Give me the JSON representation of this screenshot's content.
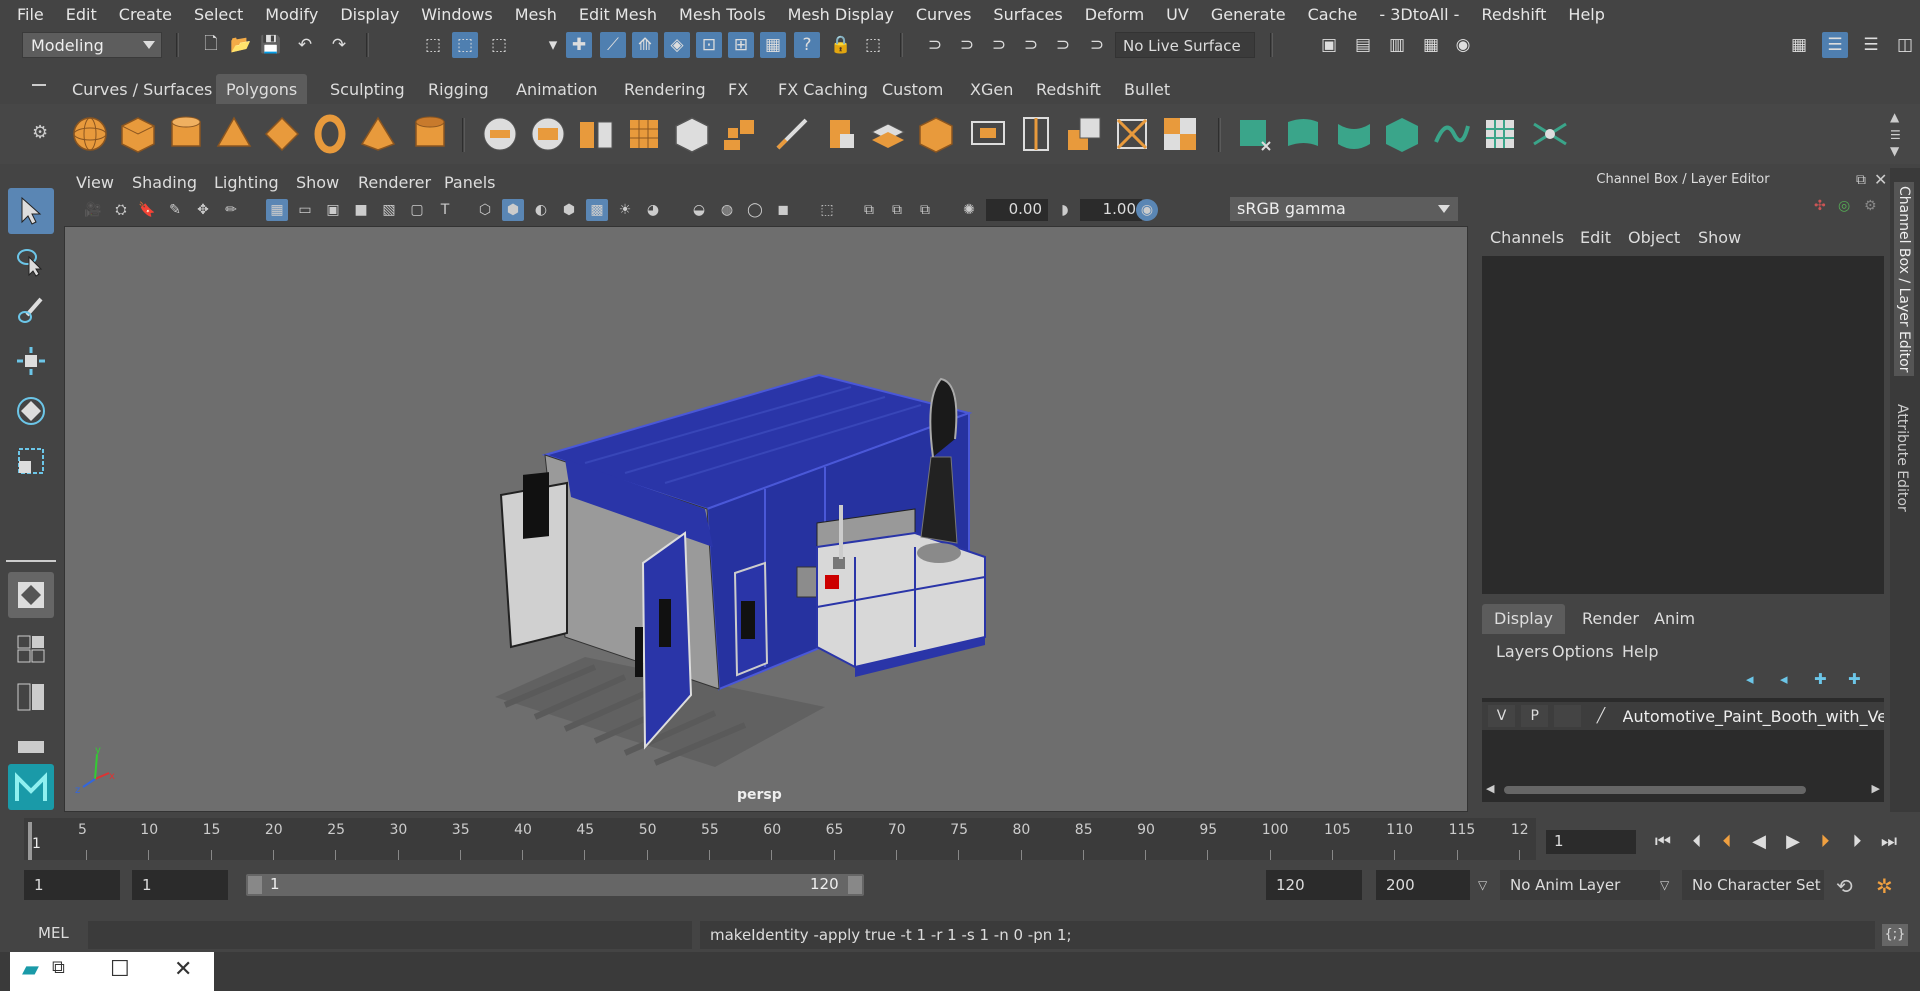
{
  "menubar": {
    "items": [
      "File",
      "Edit",
      "Create",
      "Select",
      "Modify",
      "Display",
      "Windows",
      "Mesh",
      "Edit Mesh",
      "Mesh Tools",
      "Mesh Display",
      "Curves",
      "Surfaces",
      "Deform",
      "UV",
      "Generate",
      "Cache",
      "- 3DtoAll -",
      "Redshift",
      "Help"
    ]
  },
  "statusline": {
    "mode": "Modeling",
    "live_surface": "No Live Surface"
  },
  "shelf": {
    "tabs": [
      "Curves / Surfaces",
      "Polygons",
      "Sculpting",
      "Rigging",
      "Animation",
      "Rendering",
      "FX",
      "FX Caching",
      "Custom",
      "XGen",
      "Redshift",
      "Bullet"
    ],
    "active": "Polygons"
  },
  "viewport": {
    "menus": [
      "View",
      "Shading",
      "Lighting",
      "Show",
      "Renderer",
      "Panels"
    ],
    "exposure": "0.00",
    "gamma_value": "1.00",
    "color_space": "sRGB gamma",
    "camera_label": "persp"
  },
  "channel_box": {
    "title": "Channel Box / Layer Editor",
    "menus": [
      "Channels",
      "Edit",
      "Object",
      "Show"
    ]
  },
  "layer_editor": {
    "tabs": [
      "Display",
      "Render",
      "Anim"
    ],
    "active": "Display",
    "menus": [
      "Layers",
      "Options",
      "Help"
    ],
    "layer": {
      "v": "V",
      "p": "P",
      "name": "Automotive_Paint_Booth_with_Vehicl"
    }
  },
  "side_tabs": [
    "Channel Box / Layer Editor",
    "Attribute Editor"
  ],
  "timeline": {
    "ticks": [
      "5",
      "10",
      "15",
      "20",
      "25",
      "30",
      "35",
      "40",
      "45",
      "50",
      "55",
      "60",
      "65",
      "70",
      "75",
      "80",
      "85",
      "90",
      "95",
      "100",
      "105",
      "110",
      "115",
      "12"
    ],
    "start_marker": "1",
    "current_frame": "1"
  },
  "range": {
    "start": "1",
    "playback_start": "1",
    "slider_start": "1",
    "slider_end": "120",
    "playback_end": "120",
    "end": "200",
    "anim_layer": "No Anim Layer",
    "character_set": "No Character Set"
  },
  "command": {
    "label": "MEL",
    "result": "makeIdentity -apply true -t 1 -r 1 -s 1 -n 0 -pn 1;"
  },
  "colors": {
    "accent": "#5a86b4",
    "shelf_orange": "#e89a3c",
    "shelf_teal": "#3aa58a",
    "booth_blue": "#2a35a8"
  }
}
